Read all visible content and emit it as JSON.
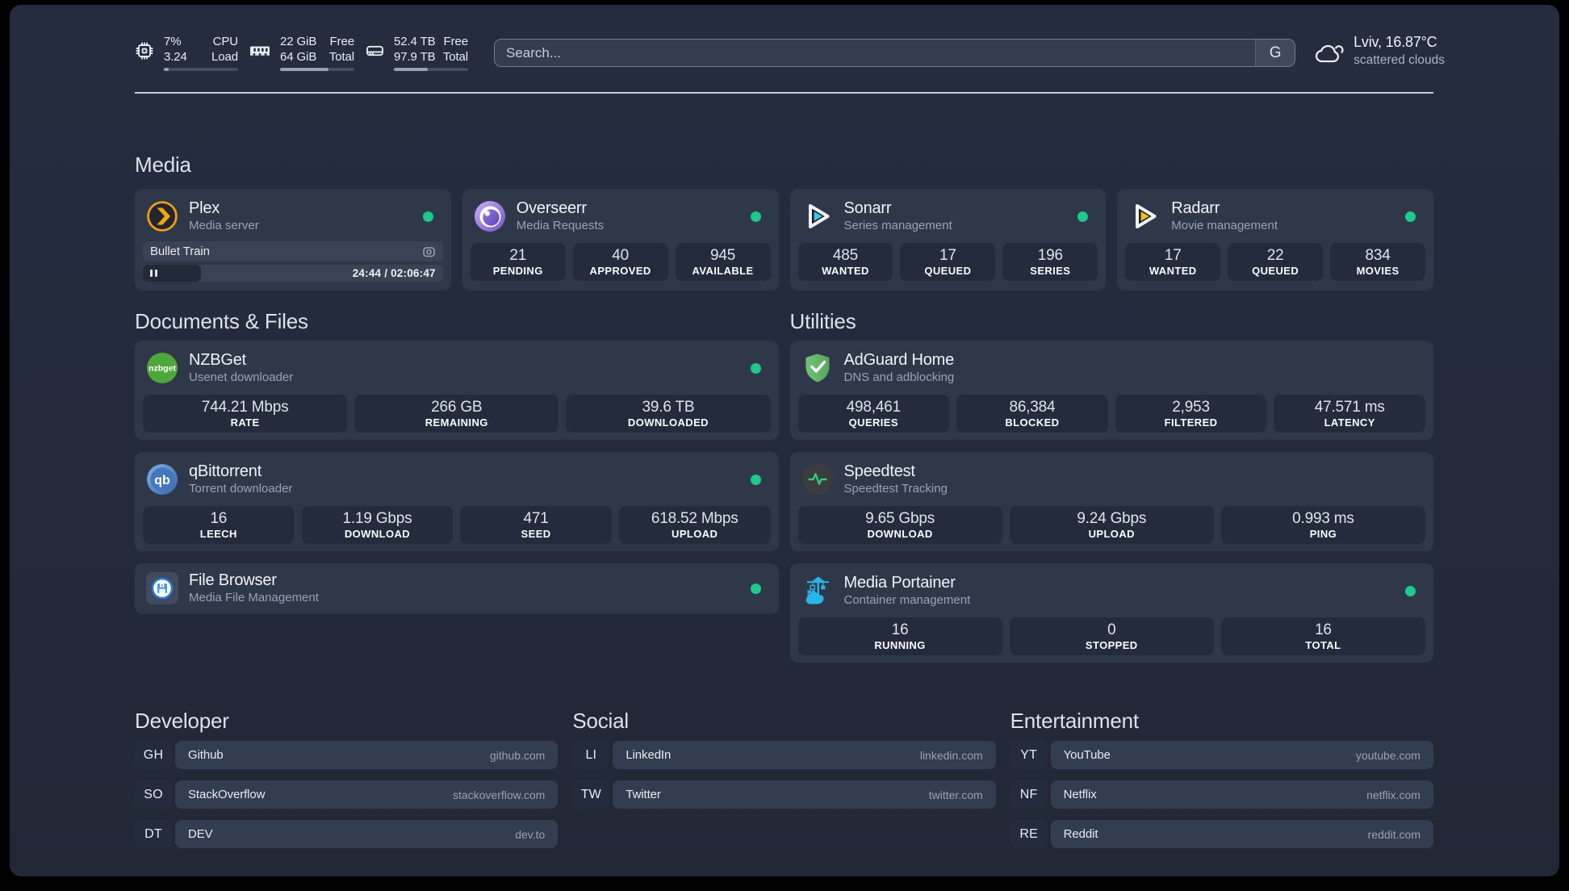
{
  "header": {
    "resources": {
      "cpu": {
        "value_top": "7%",
        "value_bottom": "3.24",
        "label_top": "CPU",
        "label_bottom": "Load",
        "progress_pct": 7
      },
      "memory": {
        "value_top": "22 GiB",
        "value_bottom": "64 GiB",
        "label_top": "Free",
        "label_bottom": "Total",
        "progress_pct": 65
      },
      "disk": {
        "value_top": "52.4 TB",
        "value_bottom": "97.9 TB",
        "label_top": "Free",
        "label_bottom": "Total",
        "progress_pct": 46
      }
    },
    "search": {
      "placeholder": "Search...",
      "button_label": "G"
    },
    "weather": {
      "location": "Lviv, 16.87°C",
      "condition": "scattered clouds"
    }
  },
  "sections": {
    "media": "Media",
    "documents": "Documents & Files",
    "utilities": "Utilities"
  },
  "status_color": "#1ec98a",
  "services": {
    "plex": {
      "name": "Plex",
      "description": "Media server",
      "now_playing": "Bullet Train",
      "time": "24:44 / 02:06:47",
      "progress_pct": 19.5
    },
    "overseerr": {
      "name": "Overseerr",
      "description": "Media Requests",
      "stats": [
        {
          "value": "21",
          "label": "PENDING"
        },
        {
          "value": "40",
          "label": "APPROVED"
        },
        {
          "value": "945",
          "label": "AVAILABLE"
        }
      ]
    },
    "sonarr": {
      "name": "Sonarr",
      "description": "Series management",
      "stats": [
        {
          "value": "485",
          "label": "WANTED"
        },
        {
          "value": "17",
          "label": "QUEUED"
        },
        {
          "value": "196",
          "label": "SERIES"
        }
      ]
    },
    "radarr": {
      "name": "Radarr",
      "description": "Movie management",
      "stats": [
        {
          "value": "17",
          "label": "WANTED"
        },
        {
          "value": "22",
          "label": "QUEUED"
        },
        {
          "value": "834",
          "label": "MOVIES"
        }
      ]
    },
    "nzbget": {
      "name": "NZBGet",
      "description": "Usenet downloader",
      "stats": [
        {
          "value": "744.21 Mbps",
          "label": "RATE"
        },
        {
          "value": "266 GB",
          "label": "REMAINING"
        },
        {
          "value": "39.6 TB",
          "label": "DOWNLOADED"
        }
      ]
    },
    "qbittorrent": {
      "name": "qBittorrent",
      "description": "Torrent downloader",
      "stats": [
        {
          "value": "16",
          "label": "LEECH"
        },
        {
          "value": "1.19 Gbps",
          "label": "DOWNLOAD"
        },
        {
          "value": "471",
          "label": "SEED"
        },
        {
          "value": "618.52 Mbps",
          "label": "UPLOAD"
        }
      ]
    },
    "filebrowser": {
      "name": "File Browser",
      "description": "Media File Management"
    },
    "adguard": {
      "name": "AdGuard Home",
      "description": "DNS and adblocking",
      "stats": [
        {
          "value": "498,461",
          "label": "QUERIES"
        },
        {
          "value": "86,384",
          "label": "BLOCKED"
        },
        {
          "value": "2,953",
          "label": "FILTERED"
        },
        {
          "value": "47.571 ms",
          "label": "LATENCY"
        }
      ]
    },
    "speedtest": {
      "name": "Speedtest",
      "description": "Speedtest Tracking",
      "stats": [
        {
          "value": "9.65 Gbps",
          "label": "DOWNLOAD"
        },
        {
          "value": "9.24 Gbps",
          "label": "UPLOAD"
        },
        {
          "value": "0.993 ms",
          "label": "PING"
        }
      ]
    },
    "portainer": {
      "name": "Media Portainer",
      "description": "Container management",
      "stats": [
        {
          "value": "16",
          "label": "RUNNING"
        },
        {
          "value": "0",
          "label": "STOPPED"
        },
        {
          "value": "16",
          "label": "TOTAL"
        }
      ]
    }
  },
  "bookmarks": {
    "developer": {
      "title": "Developer",
      "items": [
        {
          "abbr": "GH",
          "name": "Github",
          "url": "github.com"
        },
        {
          "abbr": "SO",
          "name": "StackOverflow",
          "url": "stackoverflow.com"
        },
        {
          "abbr": "DT",
          "name": "DEV",
          "url": "dev.to"
        }
      ]
    },
    "social": {
      "title": "Social",
      "items": [
        {
          "abbr": "LI",
          "name": "LinkedIn",
          "url": "linkedin.com"
        },
        {
          "abbr": "TW",
          "name": "Twitter",
          "url": "twitter.com"
        }
      ]
    },
    "entertainment": {
      "title": "Entertainment",
      "items": [
        {
          "abbr": "YT",
          "name": "YouTube",
          "url": "youtube.com"
        },
        {
          "abbr": "NF",
          "name": "Netflix",
          "url": "netflix.com"
        },
        {
          "abbr": "RE",
          "name": "Reddit",
          "url": "reddit.com"
        }
      ]
    }
  }
}
